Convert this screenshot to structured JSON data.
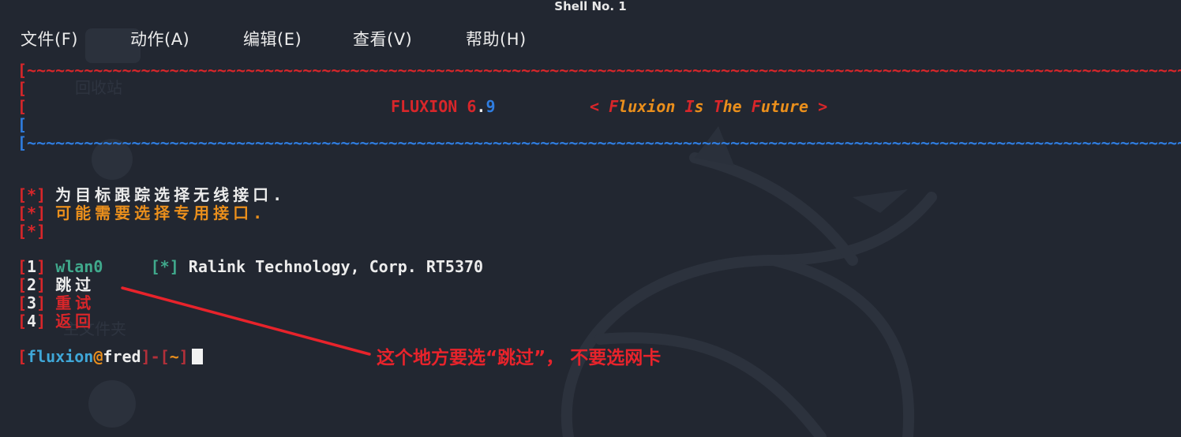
{
  "window": {
    "title": "Shell No. 1"
  },
  "menu": {
    "items": [
      {
        "label": "文件(F)"
      },
      {
        "label": "动作(A)"
      },
      {
        "label": "编辑(E)"
      },
      {
        "label": "查看(V)"
      },
      {
        "label": "帮助(H)"
      }
    ]
  },
  "banner": {
    "bracket": "[",
    "rule_chars": "~~~~~~~~~~~~~~~~~~~~~~~~~~~~~~~~~~~~~~~~~~~~~~~~~~~~~~~~~~~~~~~~~~~~~~~~~~~~~~~~~~~~~~~~~~~~~~~~~~~~~~~~~~~~~~~~~~~~~~~~~~~~~~~~~~~~~~~",
    "name": "FLUXION",
    "version_major": "6",
    "version_dot": ".",
    "version_minor": "9",
    "tagline_open": "<",
    "tagline_f": "F",
    "tagline_w1": "luxion",
    "tagline_i": "I",
    "tagline_w2": "s",
    "tagline_t": "T",
    "tagline_w3": "he",
    "tagline_fu": "F",
    "tagline_w4": "uture",
    "tagline_close": ">"
  },
  "info": {
    "star_marker": "[*]",
    "line1": "为目标跟踪选择无线接口.",
    "line2": "可能需要选择专用接口."
  },
  "options": [
    {
      "num": "1",
      "label": "wlan0",
      "detail_marker": "[*]",
      "detail": "Ralink Technology, Corp. RT5370"
    },
    {
      "num": "2",
      "label": "跳过"
    },
    {
      "num": "3",
      "label": "重试"
    },
    {
      "num": "4",
      "label": "返回"
    }
  ],
  "prompt": {
    "user": "fluxion",
    "at": "@",
    "host": "fred",
    "sep": "]-[",
    "path": "~",
    "close": "]"
  },
  "annotation": {
    "text": "这个地方要选“跳过”， 不要选网卡",
    "color": "#e8232b"
  },
  "desktop_ghost_labels": {
    "recycle": "回收站",
    "home": "主文件夹"
  },
  "colors": {
    "background": "#222731",
    "red": "#d8262a",
    "blue": "#2f7de0",
    "orange": "#ea8f1c",
    "green": "#40a98c"
  }
}
